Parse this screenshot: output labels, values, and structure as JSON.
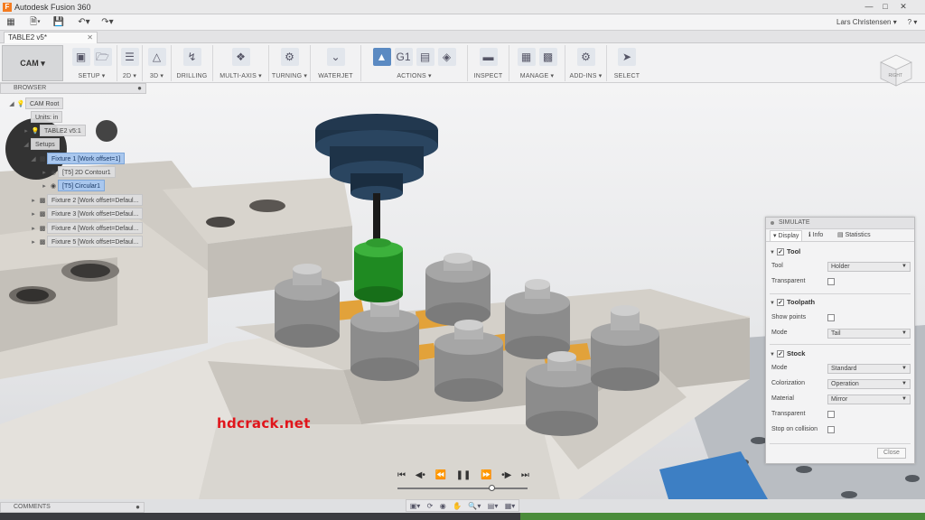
{
  "window": {
    "title": "Autodesk Fusion 360",
    "app_icon": "F"
  },
  "quick_access": {
    "user": "Lars Christensen ▾",
    "help": "? ▾"
  },
  "document_tab": {
    "label": "TABLE2 v5*"
  },
  "workspace": {
    "label": "CAM ▾"
  },
  "toolbar_groups": [
    {
      "label": "SETUP ▾"
    },
    {
      "label": "2D ▾"
    },
    {
      "label": "3D ▾"
    },
    {
      "label": "DRILLING"
    },
    {
      "label": "MULTI-AXIS ▾"
    },
    {
      "label": "TURNING ▾"
    },
    {
      "label": "WATERJET"
    },
    {
      "label": "ACTIONS ▾"
    },
    {
      "label": "INSPECT"
    },
    {
      "label": "MANAGE ▾"
    },
    {
      "label": "ADD-INS ▾"
    },
    {
      "label": "SELECT"
    }
  ],
  "browser": {
    "title": "BROWSER",
    "nodes": [
      {
        "label": "CAM Root"
      },
      {
        "label": "Units: in"
      },
      {
        "label": "TABLE2 v5:1"
      },
      {
        "label": "Setups"
      },
      {
        "label": "Fixture 1 [Work offset=1]"
      },
      {
        "label": "[T5] 2D Contour1"
      },
      {
        "label": "[T5] Circular1"
      },
      {
        "label": "Fixture 2 [Work offset=Defaul..."
      },
      {
        "label": "Fixture 3 [Work offset=Defaul..."
      },
      {
        "label": "Fixture 4 [Work offset=Defaul..."
      },
      {
        "label": "Fixture 5 [Work offset=Defaul..."
      }
    ]
  },
  "view_cube": {
    "face": "RIGHT"
  },
  "simulate": {
    "title": "SIMULATE",
    "tabs": [
      "Display",
      "Info",
      "Statistics"
    ],
    "tool": {
      "heading": "Tool",
      "mode_label": "Tool",
      "mode_value": "Holder",
      "transparent_label": "Transparent"
    },
    "toolpath": {
      "heading": "Toolpath",
      "show_points_label": "Show points",
      "mode_label": "Mode",
      "mode_value": "Tail"
    },
    "stock": {
      "heading": "Stock",
      "mode_label": "Mode",
      "mode_value": "Standard",
      "colorization_label": "Colorization",
      "colorization_value": "Operation",
      "material_label": "Material",
      "material_value": "Mirror",
      "transparent_label": "Transparent",
      "stop_label": "Stop on collision"
    },
    "close_label": "Close"
  },
  "watermark": "hdcrack.net",
  "playback": {
    "progress": 0.72
  },
  "comments": {
    "title": "COMMENTS"
  },
  "colors": {
    "accent": "#5b8ac2",
    "workpiece": "#e2a23a",
    "tool_holder": "#1e3348",
    "collet": "#2f9a2f"
  }
}
